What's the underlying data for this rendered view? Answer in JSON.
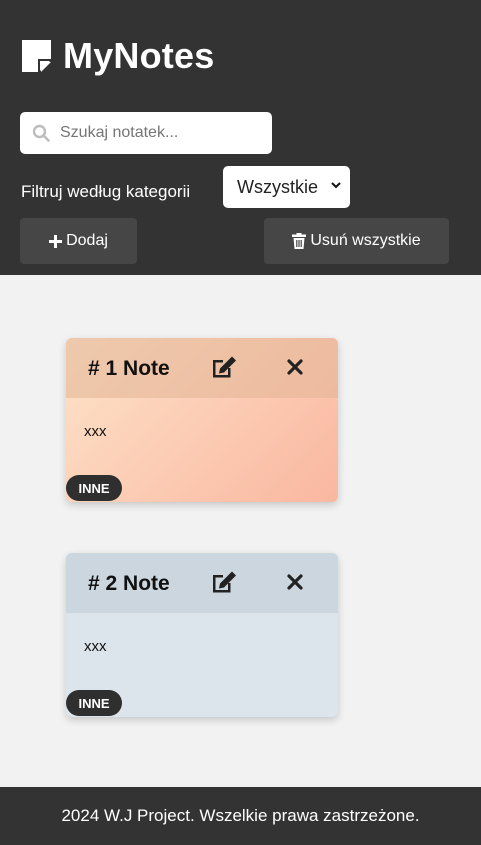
{
  "app": {
    "title": "MyNotes",
    "logo_icon": "sticky-note-icon"
  },
  "search": {
    "placeholder": "Szukaj notatek...",
    "value": "",
    "icon": "search-icon"
  },
  "filter": {
    "label": "Filtruj według kategorii",
    "selected": "Wszystkie",
    "options": [
      "Wszystkie"
    ]
  },
  "toolbar": {
    "add_label": "Dodaj",
    "add_icon": "plus-icon",
    "delete_all_label": "Usuń wszystkie",
    "delete_all_icon": "trash-icon"
  },
  "notes": [
    {
      "title": "# 1 Note",
      "content": "xxx",
      "category": "INNE",
      "color": "#fcc8b0"
    },
    {
      "title": "# 2 Note",
      "content": "xxx",
      "category": "INNE",
      "color": "#dde5ec"
    }
  ],
  "footer": {
    "text": "2024 W.J Project. Wszelkie prawa zastrzeżone."
  },
  "colors": {
    "header_bg": "#333333",
    "page_bg": "#f2f2f2",
    "button_bg": "#464646"
  }
}
